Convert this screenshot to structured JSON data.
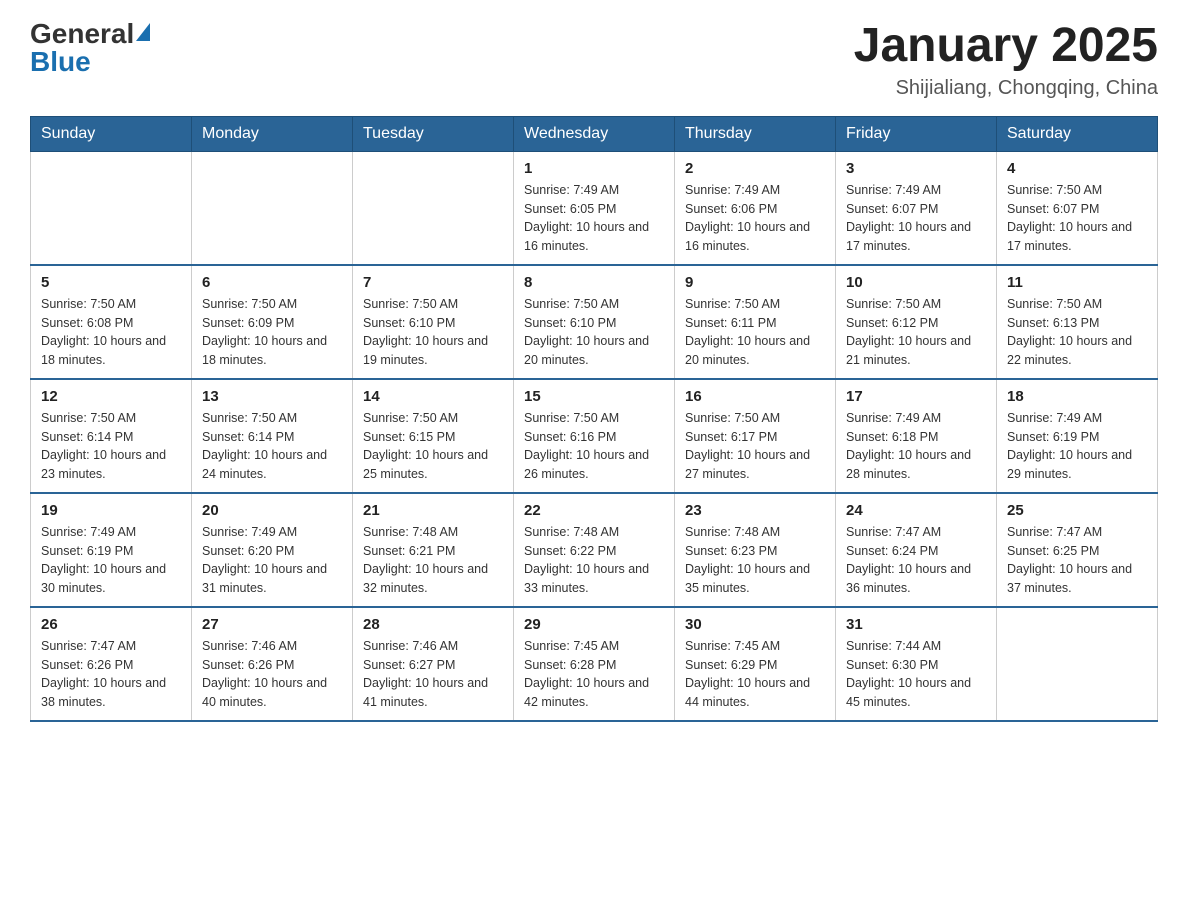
{
  "header": {
    "logo_general": "General",
    "logo_blue": "Blue",
    "month_title": "January 2025",
    "location": "Shijialiang, Chongqing, China"
  },
  "days_of_week": [
    "Sunday",
    "Monday",
    "Tuesday",
    "Wednesday",
    "Thursday",
    "Friday",
    "Saturday"
  ],
  "weeks": [
    [
      {
        "day": "",
        "sunrise": "",
        "sunset": "",
        "daylight": ""
      },
      {
        "day": "",
        "sunrise": "",
        "sunset": "",
        "daylight": ""
      },
      {
        "day": "",
        "sunrise": "",
        "sunset": "",
        "daylight": ""
      },
      {
        "day": "1",
        "sunrise": "Sunrise: 7:49 AM",
        "sunset": "Sunset: 6:05 PM",
        "daylight": "Daylight: 10 hours and 16 minutes."
      },
      {
        "day": "2",
        "sunrise": "Sunrise: 7:49 AM",
        "sunset": "Sunset: 6:06 PM",
        "daylight": "Daylight: 10 hours and 16 minutes."
      },
      {
        "day": "3",
        "sunrise": "Sunrise: 7:49 AM",
        "sunset": "Sunset: 6:07 PM",
        "daylight": "Daylight: 10 hours and 17 minutes."
      },
      {
        "day": "4",
        "sunrise": "Sunrise: 7:50 AM",
        "sunset": "Sunset: 6:07 PM",
        "daylight": "Daylight: 10 hours and 17 minutes."
      }
    ],
    [
      {
        "day": "5",
        "sunrise": "Sunrise: 7:50 AM",
        "sunset": "Sunset: 6:08 PM",
        "daylight": "Daylight: 10 hours and 18 minutes."
      },
      {
        "day": "6",
        "sunrise": "Sunrise: 7:50 AM",
        "sunset": "Sunset: 6:09 PM",
        "daylight": "Daylight: 10 hours and 18 minutes."
      },
      {
        "day": "7",
        "sunrise": "Sunrise: 7:50 AM",
        "sunset": "Sunset: 6:10 PM",
        "daylight": "Daylight: 10 hours and 19 minutes."
      },
      {
        "day": "8",
        "sunrise": "Sunrise: 7:50 AM",
        "sunset": "Sunset: 6:10 PM",
        "daylight": "Daylight: 10 hours and 20 minutes."
      },
      {
        "day": "9",
        "sunrise": "Sunrise: 7:50 AM",
        "sunset": "Sunset: 6:11 PM",
        "daylight": "Daylight: 10 hours and 20 minutes."
      },
      {
        "day": "10",
        "sunrise": "Sunrise: 7:50 AM",
        "sunset": "Sunset: 6:12 PM",
        "daylight": "Daylight: 10 hours and 21 minutes."
      },
      {
        "day": "11",
        "sunrise": "Sunrise: 7:50 AM",
        "sunset": "Sunset: 6:13 PM",
        "daylight": "Daylight: 10 hours and 22 minutes."
      }
    ],
    [
      {
        "day": "12",
        "sunrise": "Sunrise: 7:50 AM",
        "sunset": "Sunset: 6:14 PM",
        "daylight": "Daylight: 10 hours and 23 minutes."
      },
      {
        "day": "13",
        "sunrise": "Sunrise: 7:50 AM",
        "sunset": "Sunset: 6:14 PM",
        "daylight": "Daylight: 10 hours and 24 minutes."
      },
      {
        "day": "14",
        "sunrise": "Sunrise: 7:50 AM",
        "sunset": "Sunset: 6:15 PM",
        "daylight": "Daylight: 10 hours and 25 minutes."
      },
      {
        "day": "15",
        "sunrise": "Sunrise: 7:50 AM",
        "sunset": "Sunset: 6:16 PM",
        "daylight": "Daylight: 10 hours and 26 minutes."
      },
      {
        "day": "16",
        "sunrise": "Sunrise: 7:50 AM",
        "sunset": "Sunset: 6:17 PM",
        "daylight": "Daylight: 10 hours and 27 minutes."
      },
      {
        "day": "17",
        "sunrise": "Sunrise: 7:49 AM",
        "sunset": "Sunset: 6:18 PM",
        "daylight": "Daylight: 10 hours and 28 minutes."
      },
      {
        "day": "18",
        "sunrise": "Sunrise: 7:49 AM",
        "sunset": "Sunset: 6:19 PM",
        "daylight": "Daylight: 10 hours and 29 minutes."
      }
    ],
    [
      {
        "day": "19",
        "sunrise": "Sunrise: 7:49 AM",
        "sunset": "Sunset: 6:19 PM",
        "daylight": "Daylight: 10 hours and 30 minutes."
      },
      {
        "day": "20",
        "sunrise": "Sunrise: 7:49 AM",
        "sunset": "Sunset: 6:20 PM",
        "daylight": "Daylight: 10 hours and 31 minutes."
      },
      {
        "day": "21",
        "sunrise": "Sunrise: 7:48 AM",
        "sunset": "Sunset: 6:21 PM",
        "daylight": "Daylight: 10 hours and 32 minutes."
      },
      {
        "day": "22",
        "sunrise": "Sunrise: 7:48 AM",
        "sunset": "Sunset: 6:22 PM",
        "daylight": "Daylight: 10 hours and 33 minutes."
      },
      {
        "day": "23",
        "sunrise": "Sunrise: 7:48 AM",
        "sunset": "Sunset: 6:23 PM",
        "daylight": "Daylight: 10 hours and 35 minutes."
      },
      {
        "day": "24",
        "sunrise": "Sunrise: 7:47 AM",
        "sunset": "Sunset: 6:24 PM",
        "daylight": "Daylight: 10 hours and 36 minutes."
      },
      {
        "day": "25",
        "sunrise": "Sunrise: 7:47 AM",
        "sunset": "Sunset: 6:25 PM",
        "daylight": "Daylight: 10 hours and 37 minutes."
      }
    ],
    [
      {
        "day": "26",
        "sunrise": "Sunrise: 7:47 AM",
        "sunset": "Sunset: 6:26 PM",
        "daylight": "Daylight: 10 hours and 38 minutes."
      },
      {
        "day": "27",
        "sunrise": "Sunrise: 7:46 AM",
        "sunset": "Sunset: 6:26 PM",
        "daylight": "Daylight: 10 hours and 40 minutes."
      },
      {
        "day": "28",
        "sunrise": "Sunrise: 7:46 AM",
        "sunset": "Sunset: 6:27 PM",
        "daylight": "Daylight: 10 hours and 41 minutes."
      },
      {
        "day": "29",
        "sunrise": "Sunrise: 7:45 AM",
        "sunset": "Sunset: 6:28 PM",
        "daylight": "Daylight: 10 hours and 42 minutes."
      },
      {
        "day": "30",
        "sunrise": "Sunrise: 7:45 AM",
        "sunset": "Sunset: 6:29 PM",
        "daylight": "Daylight: 10 hours and 44 minutes."
      },
      {
        "day": "31",
        "sunrise": "Sunrise: 7:44 AM",
        "sunset": "Sunset: 6:30 PM",
        "daylight": "Daylight: 10 hours and 45 minutes."
      },
      {
        "day": "",
        "sunrise": "",
        "sunset": "",
        "daylight": ""
      }
    ]
  ]
}
